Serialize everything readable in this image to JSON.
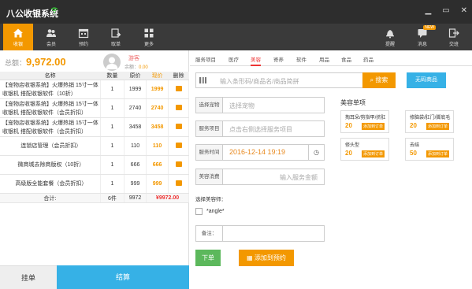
{
  "app": {
    "title": "八公收银系统"
  },
  "window": {
    "minimize": "▁",
    "restore": "▭",
    "close": "✕"
  },
  "toolbar": {
    "left": [
      {
        "label": "收银",
        "icon": "home-icon"
      },
      {
        "label": "会员",
        "icon": "members-icon"
      },
      {
        "label": "预约",
        "icon": "calendar-icon"
      },
      {
        "label": "取单",
        "icon": "pickup-order-icon"
      },
      {
        "label": "更多",
        "icon": "grid-icon"
      }
    ],
    "right": [
      {
        "label": "提醒",
        "icon": "bell-icon"
      },
      {
        "label": "消息",
        "icon": "message-icon",
        "badge": "NEW"
      },
      {
        "label": "交班",
        "icon": "handover-icon"
      }
    ]
  },
  "summary": {
    "total_label": "总额：",
    "total_value": "9,972.00"
  },
  "member": {
    "name": "游客",
    "points_label": "余额：",
    "points_value": "0.00"
  },
  "table": {
    "headers": [
      "名称",
      "数量",
      "原价",
      "现价",
      "删除"
    ],
    "rows": [
      {
        "name": "【宠物店收银系统】火爆热销 15寸一体收银机 搭配收银软件（10折）",
        "qty": "1",
        "orig": "1999",
        "price": "1999"
      },
      {
        "name": "【宠物店收银系统】火爆热销 15寸一体收银机 搭配收银软件（会员折扣）",
        "qty": "1",
        "orig": "2740",
        "price": "2740"
      },
      {
        "name": "【宠物店收银系统】火爆热销 15寸一体收银机 搭配收银软件（会员折扣）",
        "qty": "1",
        "orig": "3458",
        "price": "3458"
      },
      {
        "name": "连锁店管理（会员折扣）",
        "qty": "1",
        "orig": "110",
        "price": "110"
      },
      {
        "name": "微商城去除商版权（10折）",
        "qty": "1",
        "orig": "666",
        "price": "666"
      },
      {
        "name": "高级版全能套餐（会员折扣）",
        "qty": "1",
        "orig": "999",
        "price": "999"
      }
    ],
    "sum": {
      "label": "合计:",
      "qty": "6件",
      "orig": "9972",
      "price": "¥9972.00"
    }
  },
  "bottom": {
    "hold": "挂单",
    "settle": "结算"
  },
  "tabs": [
    "服务项目",
    "医疗",
    "美容",
    "寄养",
    "软件",
    "用品",
    "食品",
    "药品"
  ],
  "active_tab_index": 2,
  "search": {
    "placeholder": "输入条形码/商品名/商品简拼",
    "button": "搜索",
    "no_barcode": "无码商品"
  },
  "form": {
    "pet_label": "选择宠物",
    "pet_placeholder": "选择宠物",
    "service_label": "服务项目",
    "service_placeholder": "点击右侧选择服务项目",
    "time_label": "服务时间",
    "time_value": "2016-12-14 19:19",
    "amount_label": "美容消费",
    "amount_placeholder": "输入服务金额",
    "selected_label": "选择美容师：",
    "option": "*angle*",
    "remark_label": "备注："
  },
  "actions": {
    "order": "下单",
    "reserve": "添加到预约"
  },
  "services": {
    "title": "美容单项",
    "items": [
      {
        "name": "掏耳朵/剪指甲/挤肛",
        "price": "20",
        "btn": "添加到订单"
      },
      {
        "name": "修脑袋/肛门/脚底毛",
        "price": "20",
        "btn": "添加到订单"
      },
      {
        "name": "修头型",
        "price": "20",
        "btn": "添加到订单"
      },
      {
        "name": "去结",
        "price": "50",
        "btn": "添加到订单"
      }
    ]
  },
  "colors": {
    "accent": "#f39800",
    "blue": "#36b1e6",
    "green": "#5cb85c",
    "red": "#e33333"
  }
}
